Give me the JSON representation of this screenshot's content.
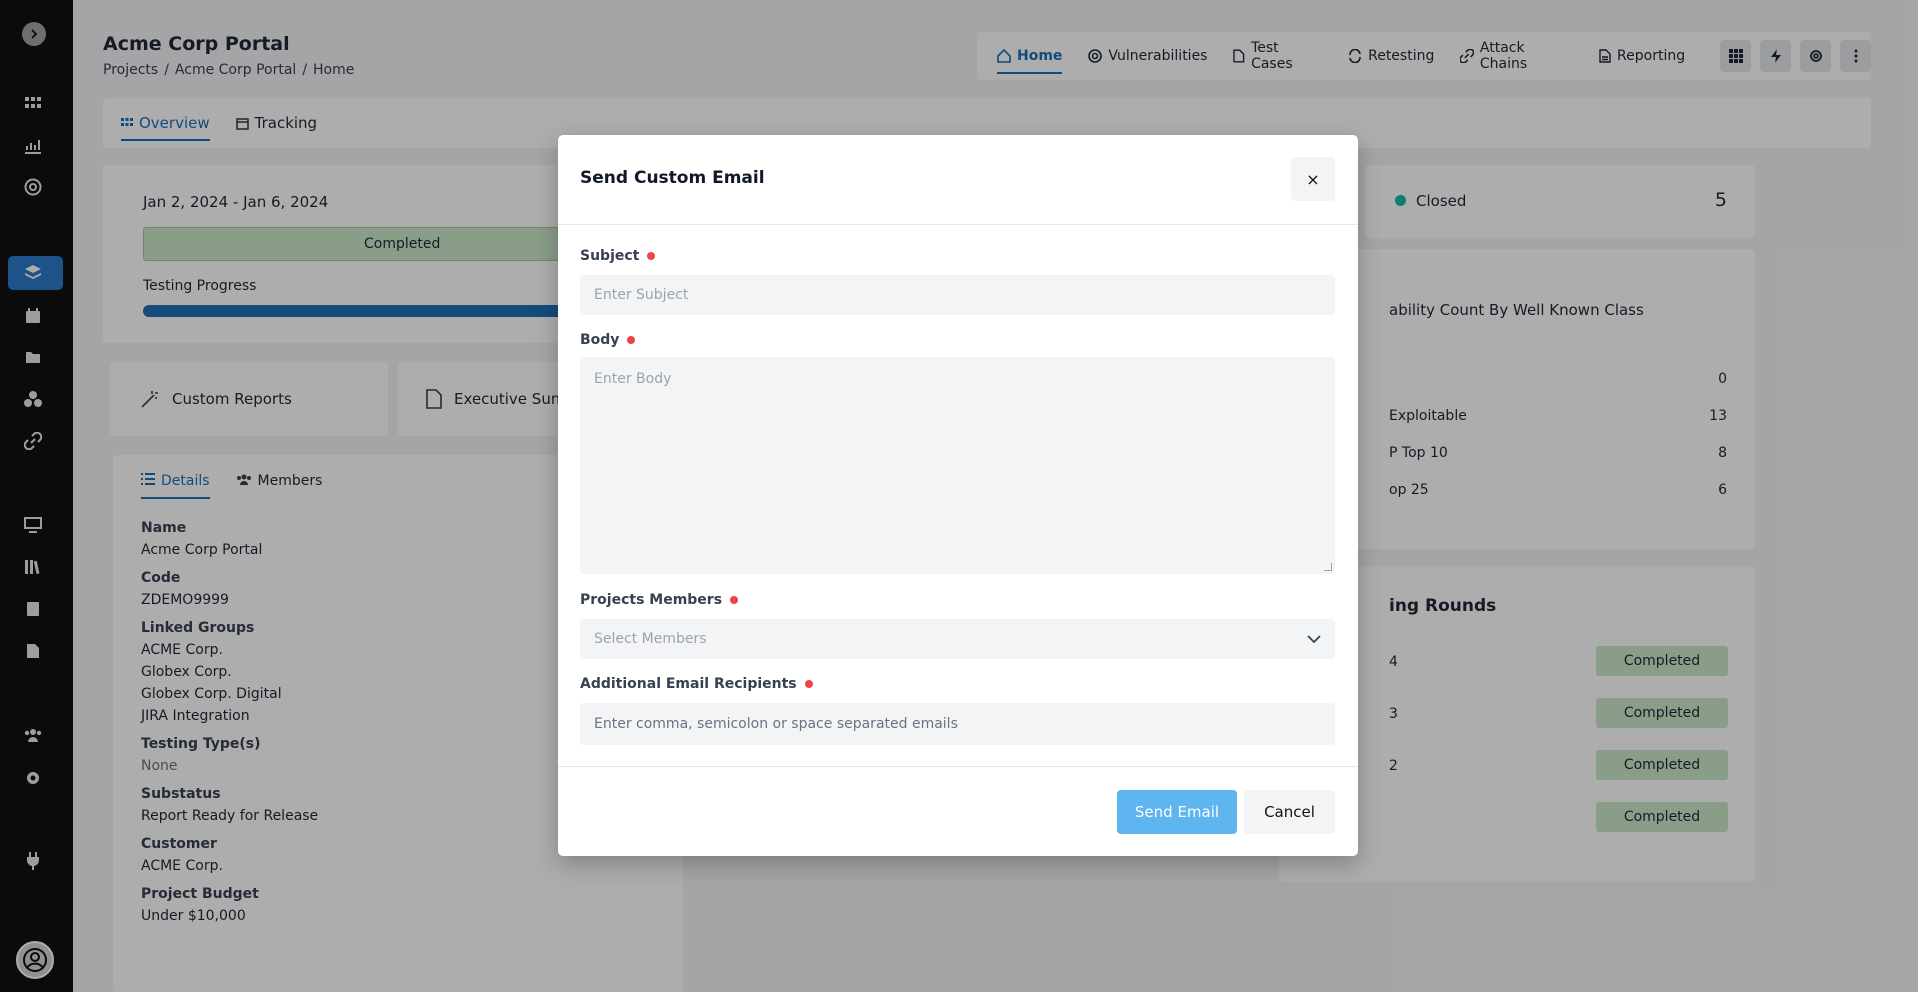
{
  "app": {
    "title": "Acme Corp Portal",
    "breadcrumbs": [
      "Projects",
      "Acme Corp Portal",
      "Home"
    ]
  },
  "topnav": {
    "items": [
      "Home",
      "Vulnerabilities",
      "Test Cases",
      "Retesting",
      "Attack Chains",
      "Reporting"
    ]
  },
  "subtabs": [
    "Overview",
    "Tracking"
  ],
  "overview": {
    "date_range": "Jan 2, 2024 - Jan 6, 2024",
    "status": "Completed",
    "progress_label": "Testing Progress",
    "progress_fraction": 1.0
  },
  "report_cards": [
    "Custom Reports",
    "Executive Summ"
  ],
  "details": {
    "tabs": [
      "Details",
      "Members"
    ],
    "fields": [
      {
        "label": "Name",
        "value": "Acme Corp Portal"
      },
      {
        "label": "Code",
        "value": "ZDEMO9999"
      },
      {
        "label": "Linked Groups",
        "values": [
          "ACME Corp.",
          "Globex Corp.",
          "Globex Corp. Digital",
          "JIRA Integration"
        ]
      },
      {
        "label": "Testing Type(s)",
        "value": "None"
      },
      {
        "label": "Substatus",
        "value": "Report Ready for Release"
      },
      {
        "label": "Customer",
        "value": "ACME Corp."
      },
      {
        "label": "Project Budget",
        "value": "Under $10,000"
      }
    ]
  },
  "closed_card": {
    "label": "Closed",
    "count": "5"
  },
  "vuln_class": {
    "title": "ability Count By Well Known Class",
    "rows": [
      {
        "label": "",
        "value": "0"
      },
      {
        "label": "Exploitable",
        "value": "13"
      },
      {
        "label": "P Top 10",
        "value": "8"
      },
      {
        "label": "op 25",
        "value": "6"
      }
    ]
  },
  "rounds": {
    "title": "ing Rounds",
    "rows": [
      {
        "label": "4",
        "status": "Completed"
      },
      {
        "label": "3",
        "status": "Completed"
      },
      {
        "label": "2",
        "status": "Completed"
      },
      {
        "label": "",
        "status": "Completed"
      }
    ]
  },
  "modal": {
    "title": "Send Custom Email",
    "close": "×",
    "subject_label": "Subject",
    "subject_placeholder": "Enter Subject",
    "body_label": "Body",
    "body_placeholder": "Enter Body",
    "members_label": "Projects Members",
    "members_placeholder": "Select Members",
    "recipients_label": "Additional Email Recipients",
    "recipients_placeholder": "Enter comma, semicolon or space separated emails",
    "send_label": "Send Email",
    "cancel_label": "Cancel"
  },
  "colors": {
    "accent": "#1f6fb5",
    "send_button": "#5eb5f0",
    "required": "#ef4444",
    "completed_badge": "#cbe8c9",
    "closed_dot": "#14b8a6"
  }
}
